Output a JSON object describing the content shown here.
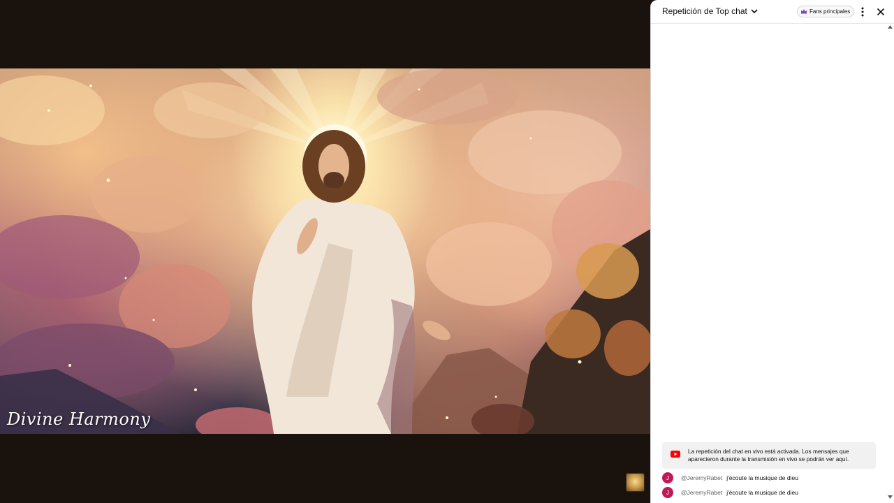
{
  "video": {
    "title_overlay": "Divine Harmony"
  },
  "chat": {
    "mode_label": "Repetición de Top chat",
    "fans_button_label": "Fans principales",
    "notice": "La repetición del chat en vivo está activada. Los mensajes que aparecieron durante la transmisión en vivo se podrán ver aquí.",
    "messages": [
      {
        "avatar_initial": "J",
        "author": "@JeremyRabet",
        "text": "j'écoute la musique de dieu"
      },
      {
        "avatar_initial": "J",
        "author": "@JeremyRabet",
        "text": "j'écoute la musique de dieu"
      }
    ]
  },
  "colors": {
    "avatar": "#c2185b",
    "youtube_red": "#ff0000",
    "crown": "#7b3fd6"
  },
  "icons": [
    "chevron-down-icon",
    "crown-icon",
    "more-vert-icon",
    "close-icon",
    "youtube-icon",
    "scroll-up-arrow",
    "scroll-down-arrow"
  ]
}
